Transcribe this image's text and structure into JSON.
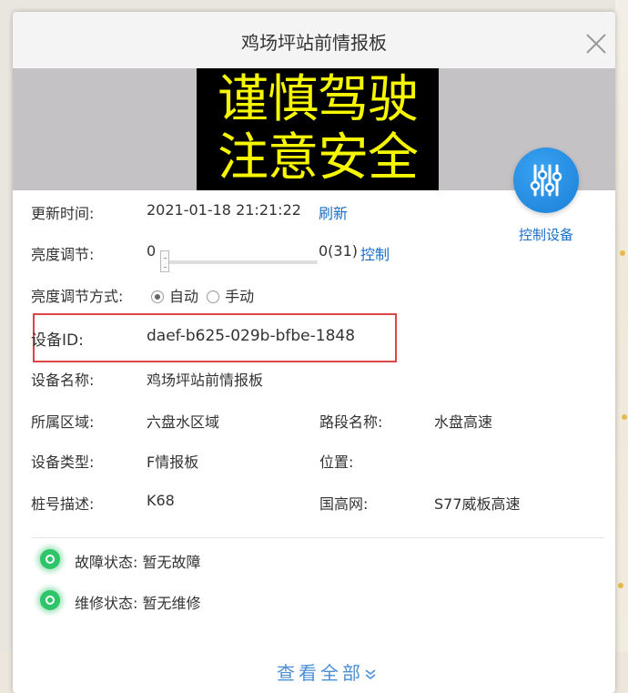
{
  "dialog": {
    "title": "鸡场坪站前情报板",
    "led_lines": [
      "谨慎驾驶",
      "注意安全"
    ],
    "control_label": "控制设备"
  },
  "fields": {
    "update_time_label": "更新时间:",
    "update_time_value": "2021-01-18 21:21:22",
    "refresh_link": "刷新",
    "brightness_label": "亮度调节:",
    "brightness_min": "0",
    "brightness_value": "0(31)",
    "brightness_level": 0,
    "brightness_max": 31,
    "brightness_control_link": "控制",
    "brightness_mode_label": "亮度调节方式:",
    "mode_auto": "自动",
    "mode_manual": "手动",
    "device_id_label": "设备ID:",
    "device_id_value": "daef-b625-029b-bfbe-1848",
    "device_name_label": "设备名称:",
    "device_name_value": "鸡场坪站前情报板",
    "region_label": "所属区域:",
    "region_value": "六盘水区域",
    "road_label": "路段名称:",
    "road_value": "水盘高速",
    "type_label": "设备类型:",
    "type_value": "F情报板",
    "position_label": "位置:",
    "position_value": "",
    "stake_label": "桩号描述:",
    "stake_value": "K68",
    "national_label": "国高网:",
    "national_value": "S77威板高速"
  },
  "status": {
    "fault": "故障状态: 暂无故障",
    "maintenance": "维修状态: 暂无维修"
  },
  "view_all": "查看全部",
  "colors": {
    "accent": "#1a6fc5",
    "status_ok": "#2ec46a",
    "highlight": "#e04545",
    "led_text": "#f6f600"
  }
}
